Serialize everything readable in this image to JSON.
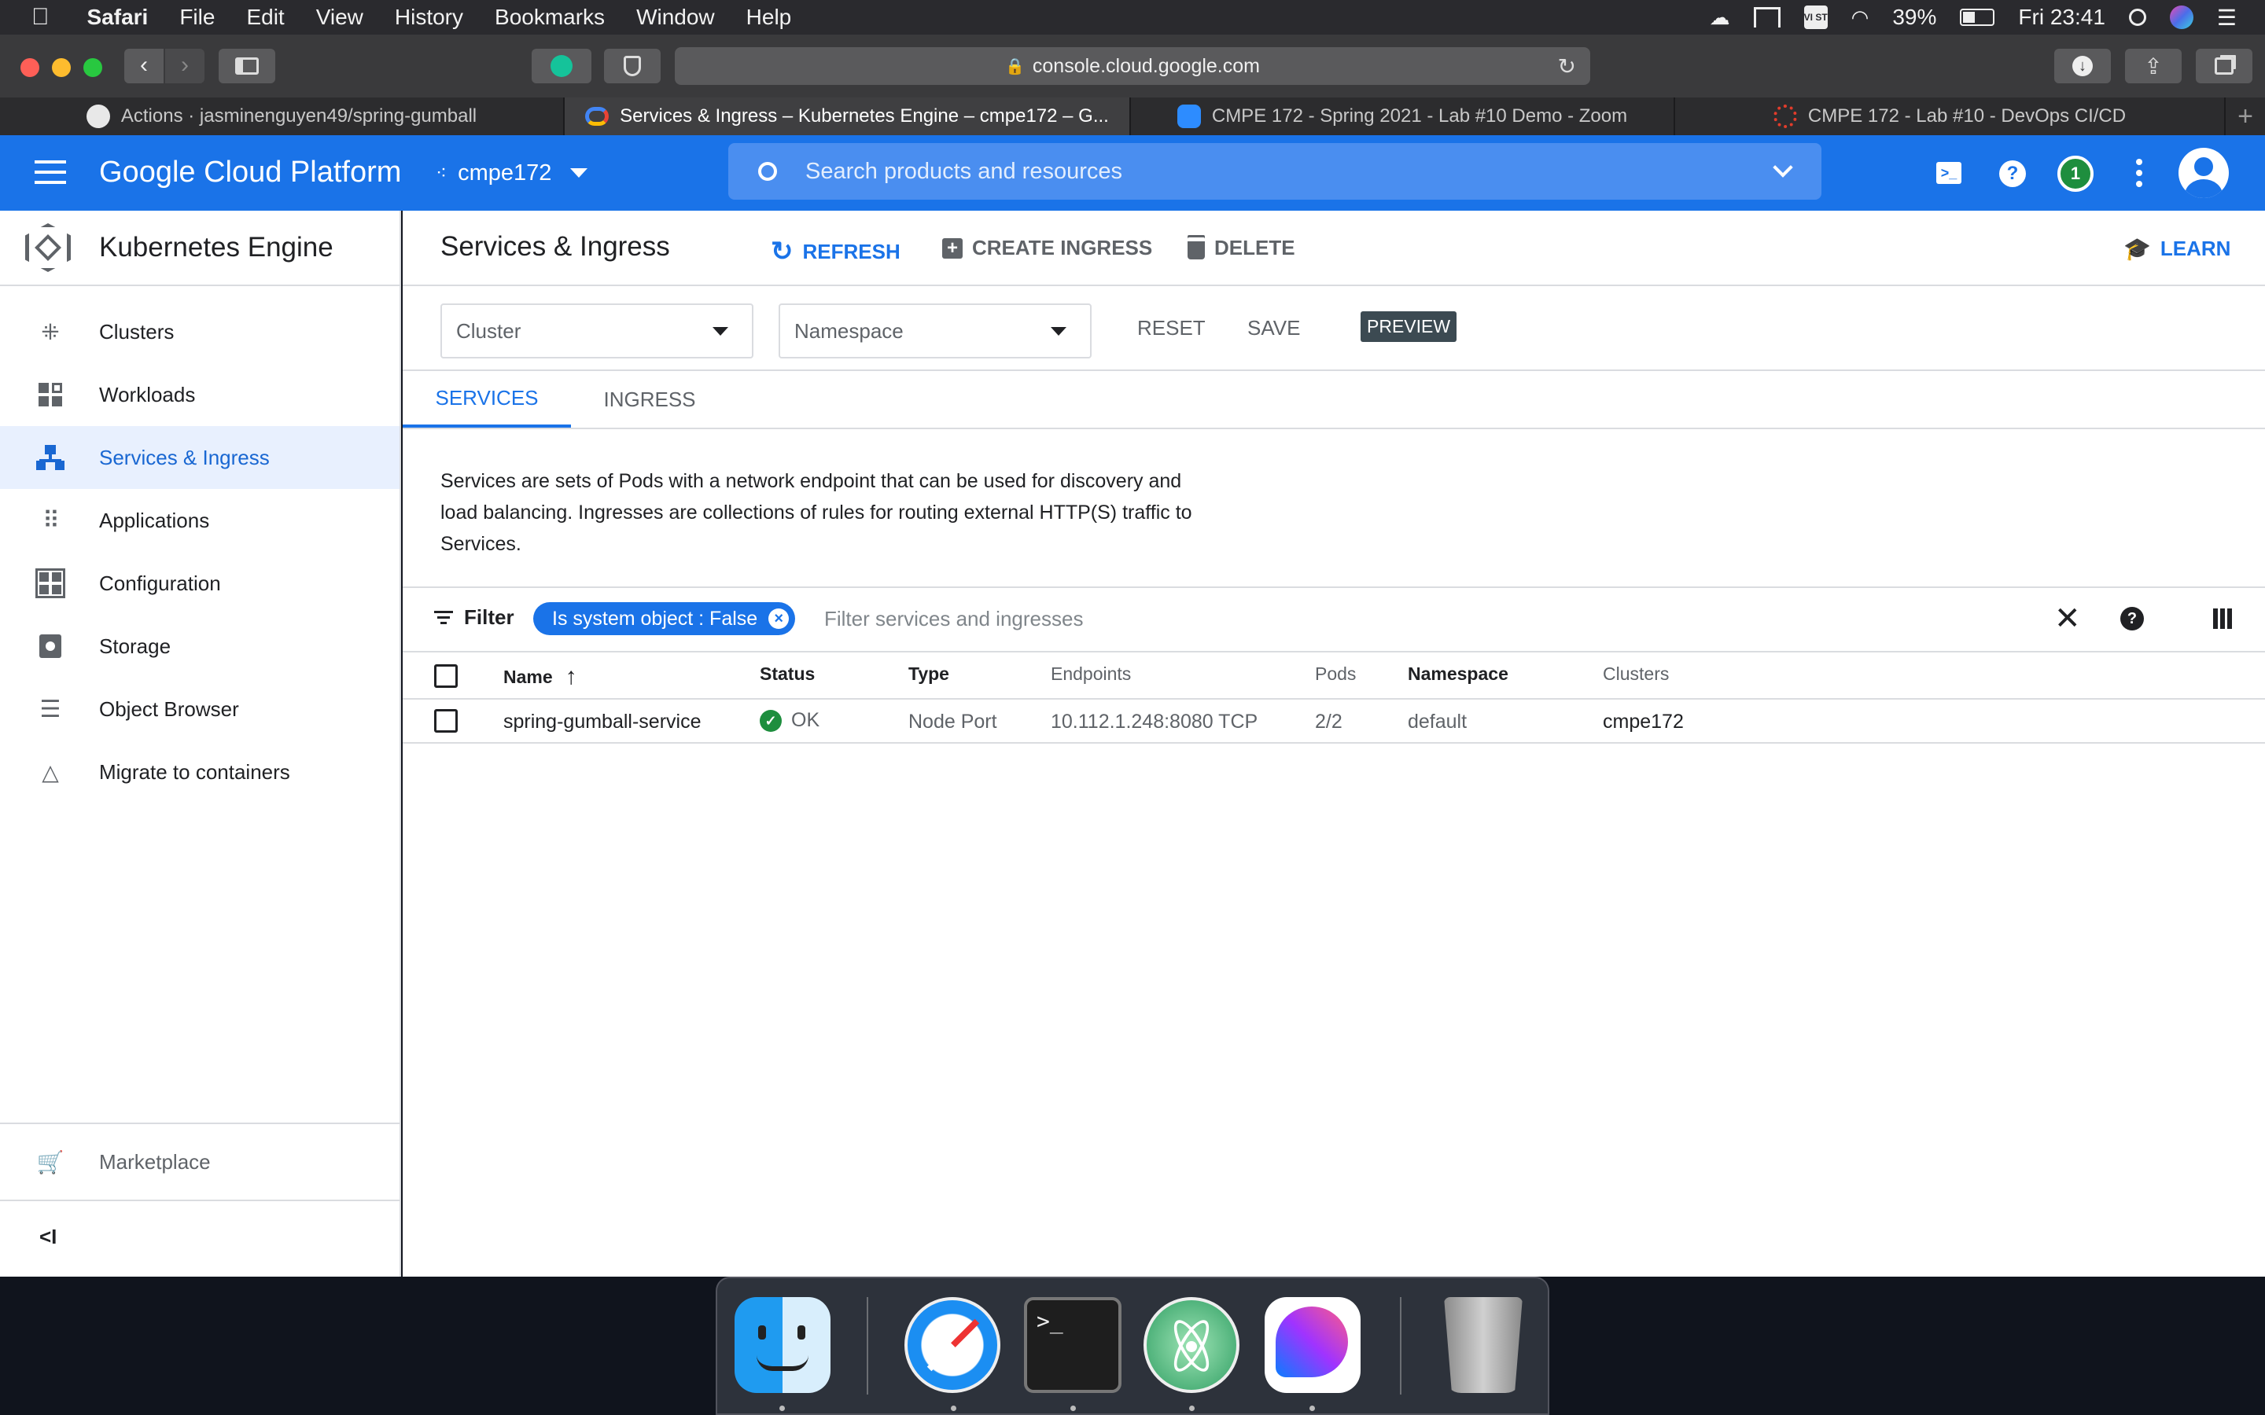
{
  "menubar": {
    "app": "Safari",
    "items": [
      "File",
      "Edit",
      "View",
      "History",
      "Bookmarks",
      "Window",
      "Help"
    ],
    "battery": "39%",
    "clock": "Fri 23:41",
    "keyboard_flag": "VI ST"
  },
  "browser": {
    "url": "console.cloud.google.com",
    "tabs": [
      {
        "label": "Actions · jasminenguyen49/spring-gumball",
        "icon": "github-icon"
      },
      {
        "label": "Services & Ingress – Kubernetes Engine – cmpe172 – G...",
        "icon": "gcp-icon"
      },
      {
        "label": "CMPE 172 - Spring 2021 - Lab #10 Demo - Zoom",
        "icon": "zoom-icon"
      },
      {
        "label": "CMPE 172 - Lab #10 - DevOps CI/CD",
        "icon": "canvas-icon"
      }
    ]
  },
  "gcp": {
    "title": "Google Cloud Platform",
    "project": "cmpe172",
    "search_placeholder": "Search products and resources",
    "notification_count": "1"
  },
  "sidebar": {
    "title": "Kubernetes Engine",
    "items": [
      {
        "label": "Clusters",
        "icon": "clusters-icon"
      },
      {
        "label": "Workloads",
        "icon": "workloads-icon"
      },
      {
        "label": "Services & Ingress",
        "icon": "services-icon"
      },
      {
        "label": "Applications",
        "icon": "applications-icon"
      },
      {
        "label": "Configuration",
        "icon": "configuration-icon"
      },
      {
        "label": "Storage",
        "icon": "storage-icon"
      },
      {
        "label": "Object Browser",
        "icon": "object-browser-icon"
      },
      {
        "label": "Migrate to containers",
        "icon": "migrate-icon"
      }
    ],
    "marketplace": "Marketplace",
    "collapse": "<I"
  },
  "page": {
    "title": "Services & Ingress",
    "refresh": "REFRESH",
    "create_ingress": "CREATE INGRESS",
    "delete": "DELETE",
    "learn": "LEARN",
    "cluster_select": "Cluster",
    "namespace_select": "Namespace",
    "reset": "RESET",
    "save": "SAVE",
    "preview": "PREVIEW",
    "tabs": [
      "SERVICES",
      "INGRESS"
    ],
    "description_lines": [
      "Services are sets of Pods with a network endpoint that can be used for discovery and",
      "load balancing. Ingresses are collections of rules for routing external HTTP(S) traffic to",
      "Services."
    ],
    "filter_label": "Filter",
    "filter_chip": "Is system object : False",
    "filter_placeholder": "Filter services and ingresses"
  },
  "table": {
    "columns": [
      "Name",
      "Status",
      "Type",
      "Endpoints",
      "Pods",
      "Namespace",
      "Clusters"
    ],
    "rows": [
      {
        "name": "spring-gumball-service",
        "status": "OK",
        "type": "Node Port",
        "endpoints": "10.112.1.248:8080 TCP",
        "pods": "2/2",
        "namespace": "default",
        "clusters": "cmpe172"
      }
    ]
  },
  "colors": {
    "gcp_blue": "#1a73e8",
    "active_blue": "#1967d2",
    "ok_green": "#1e8e3e"
  },
  "dock": [
    "finder-icon",
    "safari-icon",
    "terminal-icon",
    "atom-icon",
    "messenger-icon",
    "trash-icon"
  ]
}
